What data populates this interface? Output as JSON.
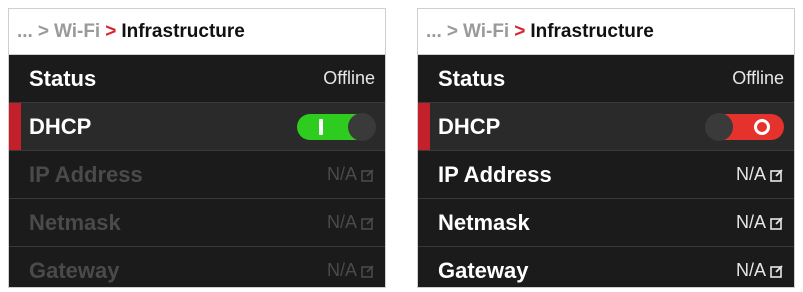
{
  "panels": [
    {
      "breadcrumb": {
        "prefix": "...",
        "parent": "Wi-Fi",
        "current": "Infrastructure"
      },
      "rows": [
        {
          "label": "Status",
          "value": "Offline"
        },
        {
          "label": "DHCP",
          "toggle": "on"
        },
        {
          "label": "IP Address",
          "value": "N/A",
          "icon": "edit-icon"
        },
        {
          "label": "Netmask",
          "value": "N/A",
          "icon": "edit-icon"
        },
        {
          "label": "Gateway",
          "value": "N/A",
          "icon": "edit-icon"
        }
      ]
    },
    {
      "breadcrumb": {
        "prefix": "...",
        "parent": "Wi-Fi",
        "current": "Infrastructure"
      },
      "rows": [
        {
          "label": "Status",
          "value": "Offline"
        },
        {
          "label": "DHCP",
          "toggle": "off"
        },
        {
          "label": "IP Address",
          "value": "N/A",
          "icon": "edit-icon"
        },
        {
          "label": "Netmask",
          "value": "N/A",
          "icon": "edit-icon"
        },
        {
          "label": "Gateway",
          "value": "N/A",
          "icon": "edit-icon"
        }
      ]
    }
  ],
  "colors": {
    "accent_red": "#d8242f",
    "toggle_on": "#2ecc1e",
    "toggle_off": "#e6322c",
    "panel_bg": "#1b1b1b"
  }
}
